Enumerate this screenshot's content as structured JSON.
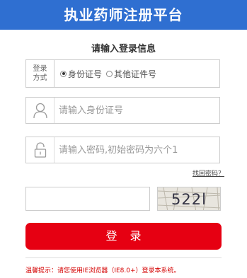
{
  "header": {
    "title": "执业药师注册平台"
  },
  "form": {
    "subtitle": "请输入登录信息",
    "login_method": {
      "label_line1": "登录",
      "label_line2": "方式",
      "options": [
        {
          "label": "身份证号",
          "checked": true
        },
        {
          "label": "其他证件号",
          "checked": false
        }
      ]
    },
    "id_field": {
      "placeholder": "请输入身份证号",
      "value": "",
      "icon": "user-icon"
    },
    "password_field": {
      "placeholder": "请输入密码,初始密码为六个1",
      "value": "",
      "icon": "lock-icon"
    },
    "forgot_password": "找回密码？",
    "captcha": {
      "input_value": "",
      "image_text": "522l"
    },
    "login_button": "登录"
  },
  "notice": "温馨提示：请您使用IE浏览器（IE8.0+）登录本系统。",
  "colors": {
    "header_bg": "#2f6fd1",
    "button_bg": "#e60012",
    "notice_text": "#d40000"
  }
}
